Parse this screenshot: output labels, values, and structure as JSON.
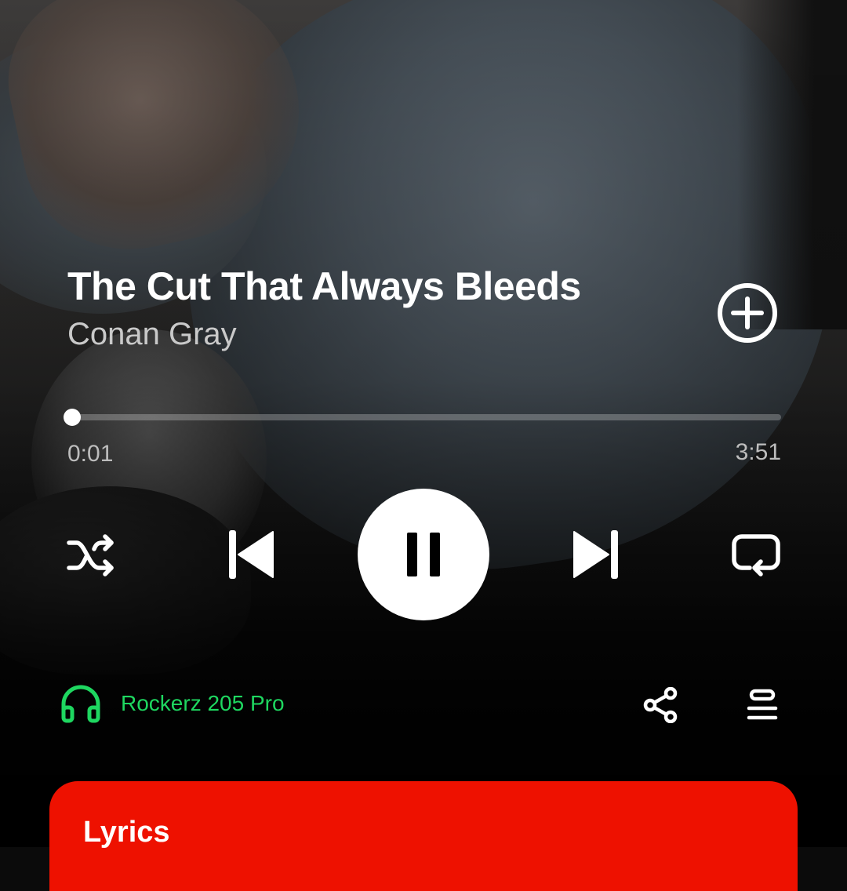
{
  "track": {
    "title": "The Cut That Always Bleeds",
    "artist": "Conan Gray"
  },
  "playback": {
    "elapsed": "0:01",
    "duration": "3:51",
    "progress_fraction": 0.004,
    "state": "playing"
  },
  "icons": {
    "add": "plus-circle-icon",
    "shuffle": "shuffle-icon",
    "previous": "skip-previous-icon",
    "pause": "pause-icon",
    "next": "skip-next-icon",
    "repeat": "repeat-icon",
    "device": "headphones-icon",
    "share": "share-icon",
    "queue": "queue-icon"
  },
  "device": {
    "name": "Rockerz 205 Pro"
  },
  "lyrics": {
    "title": "Lyrics"
  },
  "colors": {
    "accent": "#1ed760",
    "lyrics_card": "#ee1100"
  }
}
